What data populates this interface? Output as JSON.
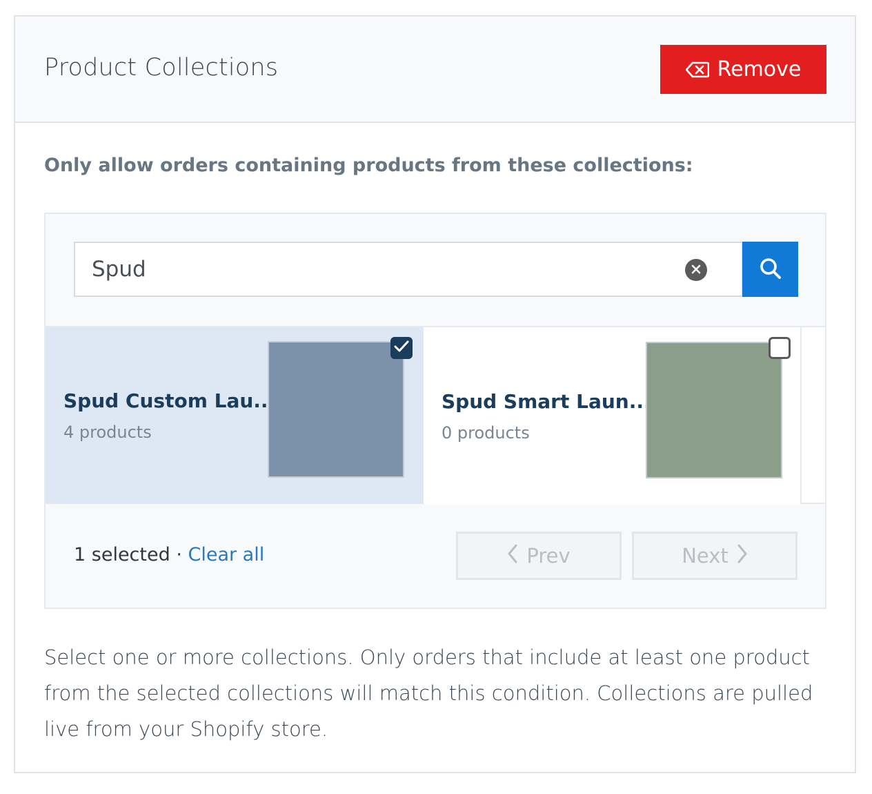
{
  "header": {
    "title": "Product Collections",
    "remove_label": "Remove",
    "remove_icon": "backspace-icon",
    "remove_color": "#e21e1e"
  },
  "section": {
    "label": "Only allow orders containing products from these collections:"
  },
  "search": {
    "value": "Spud",
    "clear_icon": "clear-x-icon",
    "search_icon": "search-icon",
    "button_color": "#1179d6"
  },
  "collections": [
    {
      "name": "Spud Custom Lau...",
      "count": "4 products",
      "selected": true,
      "image_color": "#7b92aa"
    },
    {
      "name": "Spud Smart Laun...",
      "count": "0 products",
      "selected": false,
      "image_color": "#8a9e8a"
    }
  ],
  "footer": {
    "selected_count": "1 selected",
    "separator": " · ",
    "clear_all": "Clear all",
    "prev_label": "Prev",
    "next_label": "Next"
  },
  "help": {
    "text": "Select one or more collections. Only orders that include at least one product from the selected collections will match this condition. Collections are pulled live from your Shopify store."
  }
}
